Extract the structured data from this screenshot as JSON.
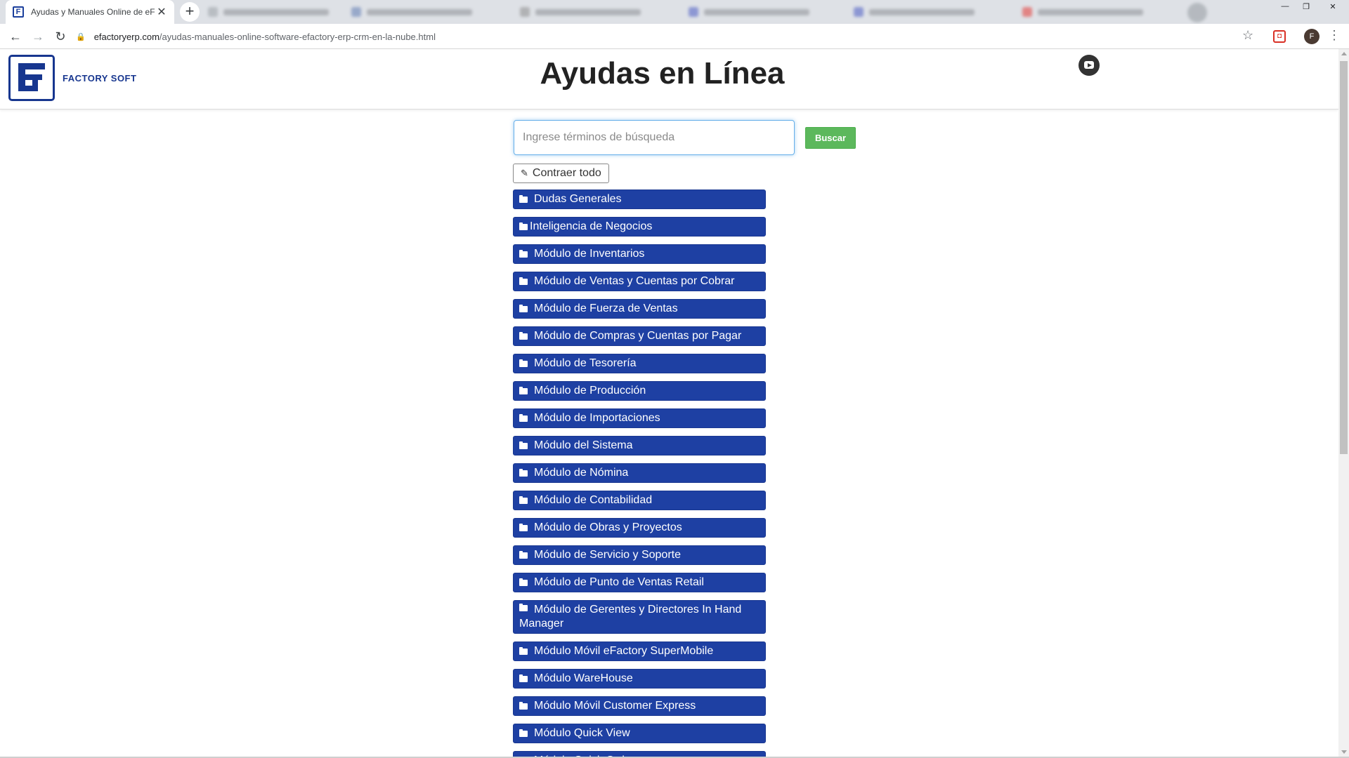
{
  "browser": {
    "tab_title": "Ayudas y Manuales Online de eF",
    "tab_close": "✕",
    "new_tab": "+",
    "url_host": "efactoryerp.com",
    "url_path": "/ayudas-manuales-online-software-efactory-erp-crm-en-la-nube.html",
    "window_controls": [
      "—",
      "❐",
      "✕"
    ]
  },
  "header": {
    "brand": "FACTORY SOFT",
    "title": "Ayudas en Línea"
  },
  "search": {
    "placeholder": "Ingrese términos de búsqueda",
    "button": "Buscar"
  },
  "collapse_all": "Contraer todo",
  "categories": [
    "Dudas Generales",
    "Inteligencia de Negocios",
    "Módulo de Inventarios",
    "Módulo de Ventas y Cuentas por Cobrar",
    "Módulo de Fuerza de Ventas",
    "Módulo de Compras y Cuentas por Pagar",
    "Módulo de Tesorería",
    "Módulo de Producción",
    "Módulo de Importaciones",
    "Módulo del Sistema",
    "Módulo de Nómina",
    "Módulo de Contabilidad",
    "Módulo de Obras y Proyectos",
    "Módulo de Servicio y Soporte",
    "Módulo de Punto de Ventas Retail",
    "Módulo de Gerentes y Directores In Hand Manager",
    "Módulo Móvil eFactory SuperMobile",
    "Módulo WareHouse",
    "Módulo Móvil Customer Express",
    "Módulo Quick View",
    "Módulo Quick Orders"
  ],
  "colors": {
    "category_bg": "#1e40a3",
    "brand_blue": "#17368f",
    "search_button": "#5cb85c"
  }
}
